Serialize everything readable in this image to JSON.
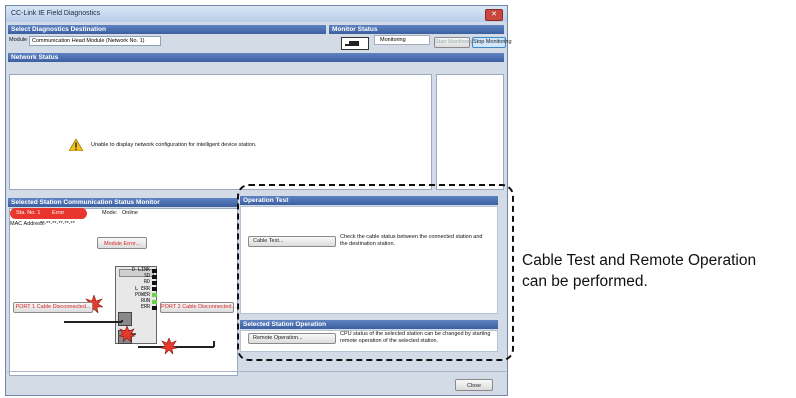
{
  "window": {
    "title": "CC-Link IE Field Diagnostics",
    "close_glyph": "✕"
  },
  "destination": {
    "header": "Select Diagnostics Destination",
    "module_label": "Module",
    "module_value": "Communication Head Module (Network No. 1)"
  },
  "monitor": {
    "header": "Monitor Status",
    "status_text": "Monitoring",
    "start_label": "Start Monitoring",
    "stop_label": "Stop Monitoring"
  },
  "network": {
    "header": "Network Status",
    "message": "Unable to display network configuration for intelligent device station."
  },
  "station_monitor": {
    "header": "Selected Station Communication Status Monitor",
    "station_label": "Sta. No. 1",
    "station_state": "Error",
    "mode_label": "Mode:",
    "mode_value": "Online",
    "mac_label": "MAC Address:",
    "mac_value": "**-**-**-**-**-**",
    "module_error_label": "Module Error...",
    "port1_label": "PORT 1 Cable Disconnected...",
    "port2_label": "PORT 2 Cable Disconnected...",
    "leds": [
      {
        "label": "D LINK",
        "color": "#111111"
      },
      {
        "label": "SD",
        "color": "#111111"
      },
      {
        "label": "RD",
        "color": "#111111"
      },
      {
        "label": "L ERR",
        "color": "#111111"
      },
      {
        "label": "POWER",
        "color": "#6ad24a"
      },
      {
        "label": "RUN",
        "color": "#6ad24a"
      },
      {
        "label": "ERR",
        "color": "#111111"
      }
    ]
  },
  "operation_test": {
    "header": "Operation Test",
    "cable_test_label": "Cable Test...",
    "cable_test_desc_1": "Check the cable status between the connected station and",
    "cable_test_desc_2": "the destination station."
  },
  "selected_operation": {
    "header": "Selected Station Operation",
    "remote_label": "Remote Operation...",
    "remote_desc_1": "CPU status of the selected station can be changed by starting",
    "remote_desc_2": "remote operation of the selected station."
  },
  "footer": {
    "close_label": "Close"
  },
  "annotation": {
    "line1": "Cable Test and Remote Operation",
    "line2": "can be performed."
  },
  "colors": {
    "header_blue": "#3c5f9f",
    "error_red": "#e8362f",
    "window_bg": "#d3dbe7"
  }
}
